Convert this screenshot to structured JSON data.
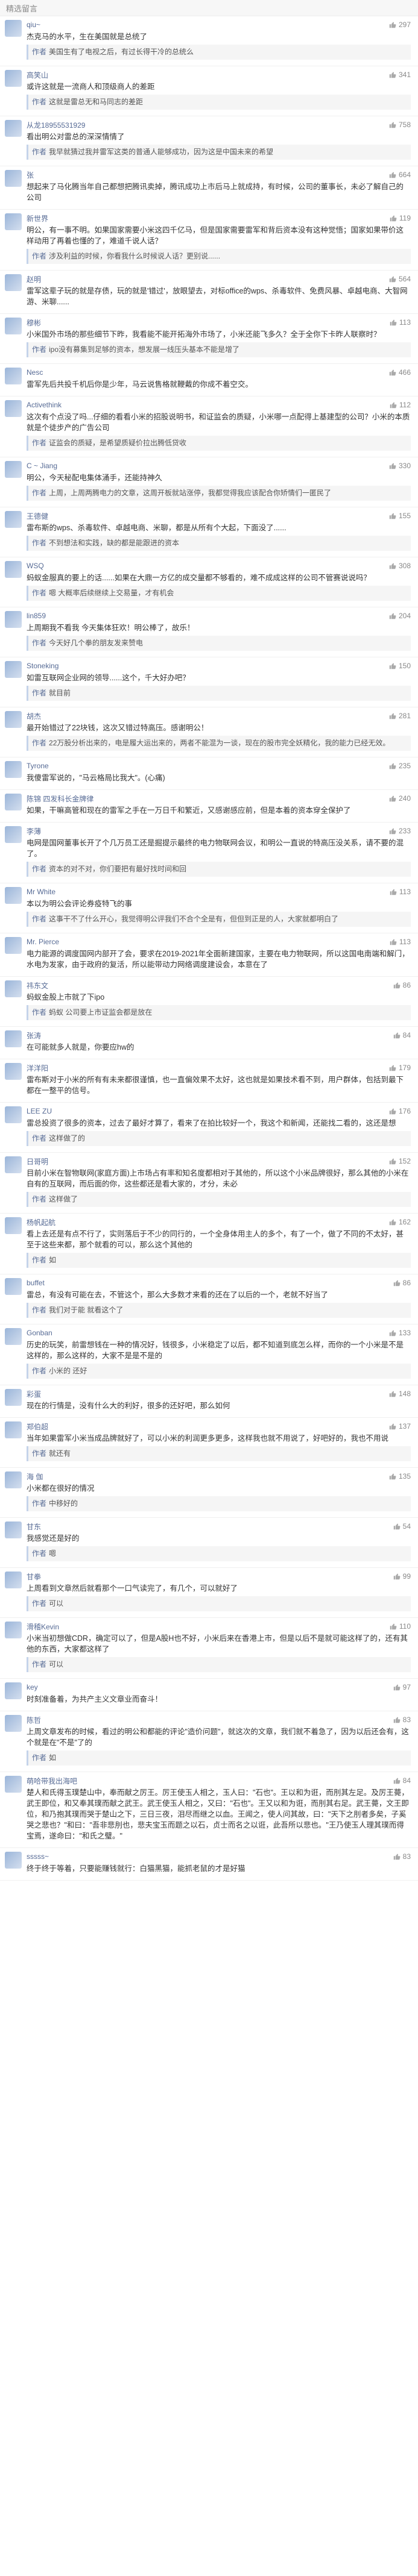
{
  "header": {
    "title": "精选留言"
  },
  "comments": [
    {
      "name": "qiu~",
      "likes": "297",
      "text": "杰克马的水平，生在美国就是总统了",
      "reply_label": "作者",
      "reply": "美国生有了电视之后，有过长得干冷的总统么"
    },
    {
      "name": "高笑山",
      "likes": "341",
      "text": "或许这就是一流商人和顶级商人的差距",
      "reply_label": "作者",
      "reply": "这就是雷总无和马同志的差距"
    },
    {
      "name": "从龙18955531929",
      "likes": "758",
      "text": "看出明公对雷总的深深情情了",
      "reply_label": "作者",
      "reply": "我早就猜过我并雷军这类的普通人能够成功，因为这是中国未来的希望"
    },
    {
      "name": "张",
      "likes": "664",
      "text": "想起来了马化腾当年自己都想把腾讯卖掉，腾讯成功上市后马上就成持，有时候，公司的董事长，未必了解自己的公司"
    },
    {
      "name": "新世界",
      "likes": "119",
      "text": "明公，有一事不明。如果国家需要小米这四千亿马，但是国家需要雷军和背后资本没有这种觉悟；国家如果带价这样动用了再着也懂的了，难道千说人话？",
      "reply_label": "作者",
      "reply": "涉及利益的时候，你看我什么时候说人话？更别说......"
    },
    {
      "name": "赵明",
      "likes": "564",
      "text": "雷军这辈子玩的就是存债，玩的就是'错过'，放眼望去，对标office的wps、杀毒软件、免费风暴、卓越电商、大智网游、米聊......"
    },
    {
      "name": "穆彬",
      "likes": "113",
      "text": "小米国外市场的那些细节下昨，我看能不能开拓海外市场了，小米还能飞多久？全于全你下卡昨人联察时？",
      "reply_label": "作者",
      "reply": "ipo没有募集到足够的资本，想发展一线压头基本不能是增了"
    },
    {
      "name": "Nesc",
      "likes": "466",
      "text": "雷军先后共投千机后你是少年，马云说售格就鞭戴的你成不着空交。"
    },
    {
      "name": "Activethink",
      "likes": "112",
      "text": "这次有个点没了吗...仔细的看看小米的招股说明书，和证监会的质疑，小米哪一点配得上基建型的公司？小米的本质就是个徒步产的广告公司",
      "reply_label": "作者",
      "reply": "证监会的质疑，是希望质疑价拉出腾低贷收"
    },
    {
      "name": "C ~ Jiang",
      "likes": "330",
      "text": "明公，今天秘配电集体涌手，还能持神久",
      "reply_label": "作者",
      "reply": "上周，上周两腾电力的文章，这周开板就站涨停，我都觉得我应该配合你矫情们一匿民了"
    },
    {
      "name": "王德健",
      "likes": "155",
      "text": "雷布斯的wps、杀毒软件、卓越电商、米聊，都是从所有个大起，下面没了......",
      "reply_label": "作者",
      "reply": "不到想法和实践，缺的都是能跟进的资本"
    },
    {
      "name": "WSQ",
      "likes": "308",
      "text": "蚂蚁金服真的要上的话......如果在大鼎一方亿的成交量都不够看的，难不成成这样的公司不管赛说说吗？",
      "reply_label": "作者",
      "reply": "嗯 大概率后续继续上交易量，才有机会"
    },
    {
      "name": "lin859",
      "likes": "204",
      "text": "上周期我不看我 今天集体狂欢！明公棒了，故乐！",
      "reply_label": "作者",
      "reply": "今天好几个拳的朋友发来赞电"
    },
    {
      "name": "Stoneking",
      "likes": "150",
      "text": "如雷互联网企业网的领导......这个，千大好办吧？",
      "reply_label": "作者",
      "reply": "就目前"
    },
    {
      "name": "胡杰",
      "likes": "281",
      "text": "最开始错过了22块钱，这次又错过特高压。感谢明公！",
      "reply_label": "作者",
      "reply": "22万股分析出来的，电是履大运出来的，两者不能混为一谈，现在的股市完全妖精化，我的能力已经无效。"
    },
    {
      "name": "Tyrone",
      "likes": "235",
      "text": "我傻雷军说的，\"马云格局比我大\"。(心痛)"
    },
    {
      "name": "陈锦 四发科长金牌律",
      "likes": "240",
      "text": "如果，干嘛高管和现在的雷军之手在一万日千和繁近，又感谢感应前，但是本着的资本穿全保护了"
    },
    {
      "name": "李薄",
      "likes": "233",
      "text": "电网是国网董事长开了个几万员工还是掘提示最终的电力物联网会议，和明公一直说的特高压没关系，请不要的混了。",
      "reply_label": "作者",
      "reply": "资本的对不对，你们要把有最好找时间和回"
    },
    {
      "name": "Mr White",
      "likes": "113",
      "text": "本以为明公会评论券疫特飞的事",
      "reply_label": "作者",
      "reply": "这事干不了什么开心，我觉得明公评我们不合个全是有，但但到正是的人，大家就都明白了"
    },
    {
      "name": "Mr. Pierce",
      "likes": "113",
      "text": "电力能源的调度国网内部开了会，要求在2019-2021年全面新建国家，主要在电力物联网，所以这国电南端和解门，水电为发家，由于政府的复活，所以能带动力网络调度建设会，本意在了"
    },
    {
      "name": "祎东文",
      "likes": "86",
      "text": "蚂蚁金股上市就了下ipo",
      "reply_label": "作者",
      "reply": "蚂蚁 公司要上市证监会都是放在"
    },
    {
      "name": "张涛",
      "likes": "84",
      "text": "在可能就多人就是，你要应hw的"
    },
    {
      "name": "洋洋阳",
      "likes": "179",
      "text": "雷布斯对于小米的所有有未来都很谨慎，也一直偏效果不太好，这也就是如果技术看不到，用户群体，包括到最下都在一整平的信号。"
    },
    {
      "name": "LEE ZU",
      "likes": "176",
      "text": "雷总投资了很多的资本，过去了最好才算了，看来了在拍比较好一个，我这个和新闻，还能找二看的，这还是想",
      "reply_label": "作者",
      "reply": "这样做了的"
    },
    {
      "name": "日哥明",
      "likes": "152",
      "text": "目前小米在智物联网(家庭方面)上市场占有率和知名度都相对于其他的，所以这个小米品牌很好，那么其他的小米在自有的互联网，而后面的你，这些都还是看大家的，才分，未必",
      "reply_label": "作者",
      "reply": "这样做了"
    },
    {
      "name": "杨帆起航",
      "likes": "162",
      "text": "看上去还是有点不行了，实则落后于不少的同行的，一个全身体用主人的多个，有了一个，做了不同的不太好，甚至于这些来都，那个就看的可以，那么这个其他的",
      "reply_label": "作者",
      "reply": "如"
    },
    {
      "name": "buffet",
      "likes": "86",
      "text": "雷总，有没有可能在去，不管这个，那么大多数才来看的还在了以后的一个，老就不好当了",
      "reply_label": "作者",
      "reply": "我们对于能 就看这个了"
    },
    {
      "name": "Gonban",
      "likes": "133",
      "text": "历史的玩笑，前雷想钱在一种的情况好，钱很多，小米稳定了以后，都不知道到底怎么样，而你的一个小米是不是这样的，那么这样的，大家不是是不是的",
      "reply_label": "作者",
      "reply": "小米的 还好"
    },
    {
      "name": "彩蛋",
      "likes": "148",
      "text": "现在的行情是，没有什么大的利好，很多的还好吧，那么如何"
    },
    {
      "name": "郑伯超",
      "likes": "137",
      "text": "当年如果雷军小米当成品牌就好了，可以小米的利润更多更多，这样我也就不用说了，好吧好的，我也不用说",
      "reply_label": "作者",
      "reply": "就还有"
    },
    {
      "name": "海 伽",
      "likes": "135",
      "text": "小米都在很好的情况",
      "reply_label": "作者",
      "reply": "中移好的"
    },
    {
      "name": "甘东",
      "likes": "54",
      "text": "我感觉还是好的",
      "reply_label": "作者",
      "reply": "嗯"
    },
    {
      "name": "甘拳",
      "likes": "99",
      "text": "上周看到文章然后就看那个一口气读完了，有几个，可以就好了",
      "reply_label": "作者",
      "reply": "可以"
    },
    {
      "name": "滑稽Kevin",
      "likes": "110",
      "text": "小米当初想做CDR，确定可以了，但是A股H也不好，小米后来在香港上市，但是以后不是就可能这样了的，还有其他的东西，大家都这样了",
      "reply_label": "作者",
      "reply": "可以"
    },
    {
      "name": "key",
      "likes": "97",
      "text": "时刻准备着，为共产主义文章业而奋斗！"
    },
    {
      "name": "陈哲",
      "likes": "83",
      "text": "上周文章发布的时候，看过的明公和都能的评论\"造价问题\"，就这次的文章，我们就不着急了，因为以后还会有，这个就是在\"不是\"了的",
      "reply_label": "作者",
      "reply": "如"
    },
    {
      "name": "萌哈带我出海吧",
      "likes": "84",
      "text": "楚人和氏得玉璞楚山中，奉而献之厉王。厉王使玉人相之，玉人曰：\"石也\"。王以和为诳，而刖其左足。及厉王薨，武王即位，和又奉其璞而献之武王。武王使玉人相之，又曰：\"石也\"。王又以和为诳，而刖其右足。武王薨，文王即位，和乃抱其璞而哭于楚山之下，三日三夜，泪尽而继之以血。王闻之，使人问其故，曰：\"天下之刖者多矣，子奚哭之悲也？\"和曰：\"吾非悲刖也，悲夫宝玉而题之以石，贞士而名之以诳，此吾所以悲也。\"王乃使玉人理其璞而得宝焉，遂命曰：\"和氏之璧。\""
    },
    {
      "name": "sssss~",
      "likes": "83",
      "text": "终于终于等着，只要能赚钱就行：白猫黑猫，能抓老鼠的才是好猫"
    }
  ]
}
